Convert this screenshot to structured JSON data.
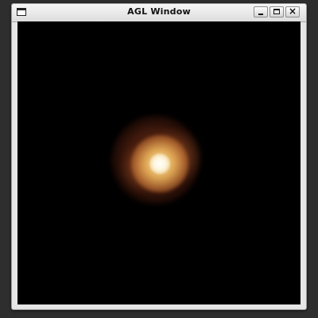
{
  "window": {
    "title": "AGL Window",
    "controls": {
      "minimize": "_",
      "maximize": "",
      "close": "×"
    }
  },
  "icons": {
    "window": "window-icon",
    "minimize": "minimize-icon",
    "maximize": "maximize-icon",
    "close": "close-icon"
  },
  "colors": {
    "canvas_background": "#000000",
    "glow_core": "#ffffff",
    "glow_mid": "#f0b95f",
    "glow_outer": "#be5a28"
  }
}
